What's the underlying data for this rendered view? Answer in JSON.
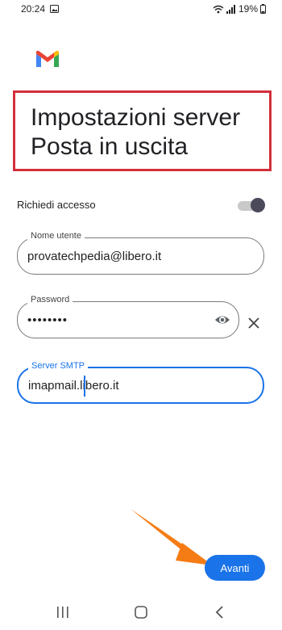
{
  "status_bar": {
    "time": "20:24",
    "battery": "19%",
    "icons": [
      "photo-icon",
      "wifi-icon",
      "signal-icon",
      "battery-icon"
    ]
  },
  "header": {
    "logo": "gmail-logo",
    "title_line1": "Impostazioni server",
    "title_line2": "Posta in uscita"
  },
  "form": {
    "require_signin": {
      "label": "Richiedi accesso",
      "enabled": true
    },
    "username": {
      "label": "Nome utente",
      "value": "provatechpedia@libero.it"
    },
    "password": {
      "label": "Password",
      "value": "••••••••"
    },
    "smtp": {
      "label": "Server SMTP",
      "value": "imapmail.libero.it"
    }
  },
  "actions": {
    "next_label": "Avanti"
  },
  "colors": {
    "accent": "#1a73e8",
    "highlight_box": "#d32f3a",
    "annotation_arrow": "#f57c14"
  },
  "nav": {
    "icons": [
      "recents-icon",
      "home-icon",
      "back-icon"
    ]
  }
}
